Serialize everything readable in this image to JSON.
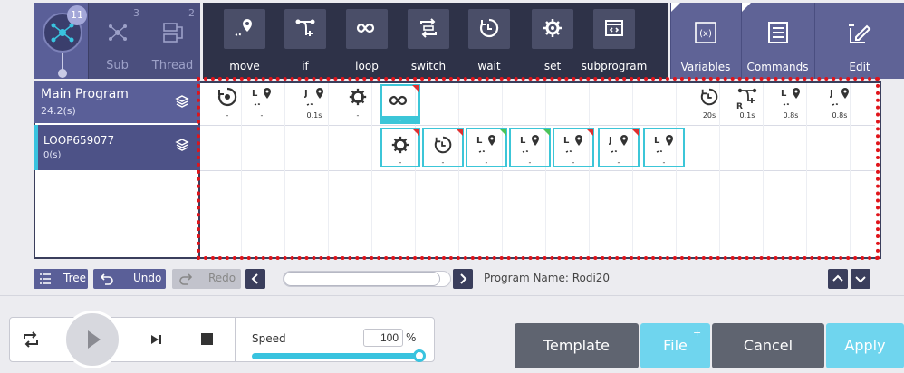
{
  "modes": {
    "main_count": "11",
    "sub": {
      "label": "Sub",
      "count": "3"
    },
    "thread": {
      "label": "Thread",
      "count": "2"
    }
  },
  "commands": [
    {
      "label": "move",
      "icon": "move-pin-icon"
    },
    {
      "label": "if",
      "icon": "if-branch-icon"
    },
    {
      "label": "loop",
      "icon": "loop-infinity-icon"
    },
    {
      "label": "switch",
      "icon": "switch-icon"
    },
    {
      "label": "wait",
      "icon": "wait-clock-icon"
    },
    {
      "label": "set",
      "icon": "set-gear-icon"
    },
    {
      "label": "subprogram",
      "icon": "subprogram-icon"
    }
  ],
  "side_actions": [
    {
      "label": "Variables",
      "icon": "variables-icon"
    },
    {
      "label": "Commands",
      "icon": "commands-list-icon"
    },
    {
      "label": "Edit",
      "icon": "edit-icon"
    }
  ],
  "tree": {
    "main": {
      "name": "Main Program",
      "time": "24.2(s)"
    },
    "loop": {
      "name": "LOOP659077",
      "time": "0(s)"
    }
  },
  "row1_blocks": [
    {
      "type": "home",
      "value": "-"
    },
    {
      "type": "L",
      "value": "-"
    },
    {
      "type": "J",
      "value": "0.1s"
    },
    {
      "type": "gear",
      "value": "-"
    },
    {
      "type": "loop",
      "value": "-"
    }
  ],
  "row1_tail_blocks": [
    {
      "type": "wait",
      "value": "20s"
    },
    {
      "type": "if",
      "value": "0.1s",
      "prefix": "R"
    },
    {
      "type": "L",
      "value": "0.8s"
    },
    {
      "type": "J",
      "value": "0.8s"
    }
  ],
  "row2_blocks": [
    {
      "type": "gear",
      "value": "-"
    },
    {
      "type": "wait",
      "value": "-"
    },
    {
      "type": "L",
      "value": "-"
    },
    {
      "type": "L",
      "value": "-"
    },
    {
      "type": "L",
      "value": "-"
    },
    {
      "type": "J",
      "value": "-"
    },
    {
      "type": "L",
      "value": "-"
    }
  ],
  "controls": {
    "tree": "Tree",
    "undo": "Undo",
    "redo": "Redo",
    "program_name": "Program Name: Rodi20"
  },
  "player": {
    "speed_label": "Speed",
    "speed_value": "100",
    "speed_unit": "%"
  },
  "buttons": {
    "template": "Template",
    "file": "File",
    "file_plus": "+",
    "cancel": "Cancel",
    "apply": "Apply"
  }
}
